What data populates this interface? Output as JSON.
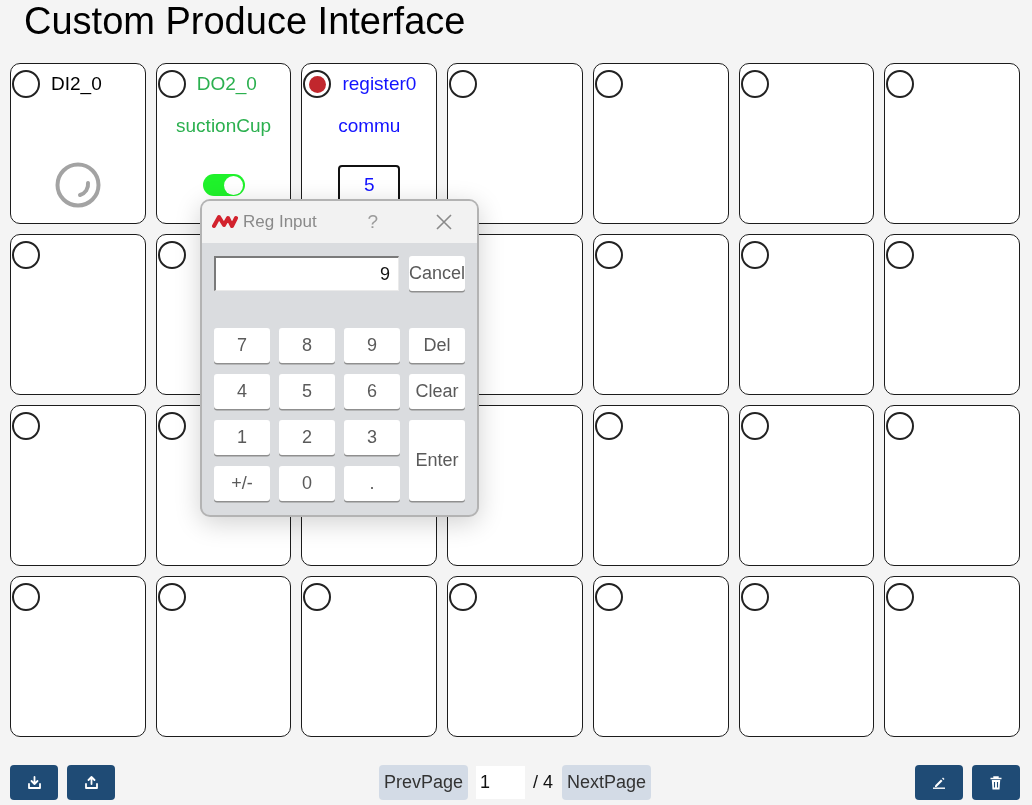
{
  "title": "Custom Produce Interface",
  "cells": [
    {
      "kind": "input",
      "selected": false,
      "name": "DI2_0"
    },
    {
      "kind": "output",
      "selected": false,
      "name": "DO2_0",
      "label": "suctionCup",
      "on": true
    },
    {
      "kind": "register",
      "selected": true,
      "name": "register0",
      "label": "commu",
      "value": "5"
    },
    {
      "kind": "empty",
      "selected": false
    },
    {
      "kind": "empty",
      "selected": false
    },
    {
      "kind": "empty",
      "selected": false
    },
    {
      "kind": "empty",
      "selected": false
    },
    {
      "kind": "empty",
      "selected": false
    },
    {
      "kind": "empty",
      "selected": false
    },
    {
      "kind": "empty"
    },
    {
      "kind": "empty"
    },
    {
      "kind": "empty",
      "selected": false
    },
    {
      "kind": "empty",
      "selected": false
    },
    {
      "kind": "empty",
      "selected": false
    },
    {
      "kind": "empty",
      "selected": false
    },
    {
      "kind": "empty",
      "selected": false
    },
    {
      "kind": "empty"
    },
    {
      "kind": "empty"
    },
    {
      "kind": "empty",
      "selected": false
    },
    {
      "kind": "empty",
      "selected": false
    },
    {
      "kind": "empty",
      "selected": false
    },
    {
      "kind": "empty",
      "selected": false
    },
    {
      "kind": "empty",
      "selected": false
    },
    {
      "kind": "empty",
      "selected": false
    },
    {
      "kind": "empty",
      "selected": false
    },
    {
      "kind": "empty",
      "selected": false
    },
    {
      "kind": "empty",
      "selected": false
    },
    {
      "kind": "empty",
      "selected": false
    }
  ],
  "dialog": {
    "title": "Reg Input",
    "help": "?",
    "value": "9",
    "cancel": "Cancel",
    "keys": [
      {
        "label": "7",
        "kind": "key"
      },
      {
        "label": "8",
        "kind": "key"
      },
      {
        "label": "9",
        "kind": "key"
      },
      {
        "label": "Del",
        "kind": "key"
      },
      {
        "label": "4",
        "kind": "key"
      },
      {
        "label": "5",
        "kind": "key"
      },
      {
        "label": "6",
        "kind": "key"
      },
      {
        "label": "Clear",
        "kind": "key"
      },
      {
        "label": "1",
        "kind": "key"
      },
      {
        "label": "2",
        "kind": "key"
      },
      {
        "label": "3",
        "kind": "key"
      },
      {
        "label": "Enter",
        "kind": "tall"
      },
      {
        "label": "+/-",
        "kind": "key"
      },
      {
        "label": "0",
        "kind": "key"
      },
      {
        "label": ".",
        "kind": "key"
      }
    ]
  },
  "pager": {
    "prev": "PrevPage",
    "page": "1",
    "total": "/ 4",
    "next": "NextPage"
  }
}
